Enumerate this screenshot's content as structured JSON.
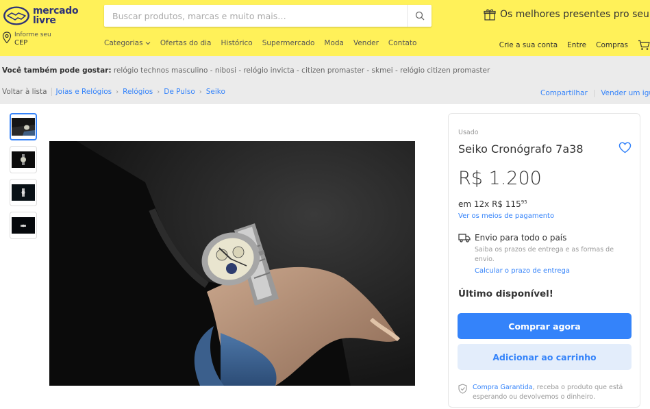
{
  "brand": {
    "line1": "mercado",
    "line2": "livre"
  },
  "search": {
    "placeholder": "Buscar produtos, marcas e muito mais…"
  },
  "promo": {
    "text": "Os melhores presentes pro seu pai!"
  },
  "location": {
    "label": "Informe seu",
    "value": "CEP"
  },
  "nav": [
    "Categorias",
    "Ofertas do dia",
    "Histórico",
    "Supermercado",
    "Moda",
    "Vender",
    "Contato"
  ],
  "account": {
    "create": "Crie a sua conta",
    "login": "Entre",
    "purchases": "Compras"
  },
  "suggestions": {
    "label": "Você também pode gostar:",
    "text": "relógio technos masculino - nibosi - relógio invicta - citizen promaster - skmei - relógio citizen promaster"
  },
  "breadcrumb": {
    "back": "Voltar à lista",
    "items": [
      "Joias e Relógios",
      "Relógios",
      "De Pulso",
      "Seiko"
    ]
  },
  "actions": {
    "share": "Compartilhar",
    "sell": "Vender um igual"
  },
  "product": {
    "condition": "Usado",
    "title": "Seiko Cronógrafo 7a38",
    "price": "R$ 1.200",
    "installments_prefix": "em 12x R$ 115",
    "installments_cents": "95",
    "payment_link": "Ver os meios de pagamento",
    "shipping_title": "Envio para todo o país",
    "shipping_desc": "Saiba os prazos de entrega e as formas de envio.",
    "shipping_link": "Calcular o prazo de entrega",
    "stock": "Último disponível!",
    "buy_label": "Comprar agora",
    "cart_label": "Adicionar ao carrinho",
    "guarantee_link": "Compra Garantida",
    "guarantee_text": ", receba o produto que está esperando ou devolvemos o dinheiro."
  },
  "colors": {
    "brand_yellow": "#fff159",
    "accent_blue": "#3483fa",
    "light_blue": "#e3edfb"
  }
}
